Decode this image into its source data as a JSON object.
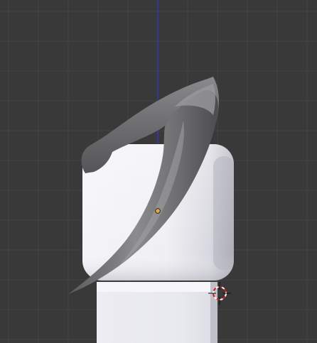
{
  "viewport": {
    "view": "3d-viewport",
    "background_color": "#393939",
    "grid_line_color": "#444444",
    "axis_color": "#3a3ad8",
    "grid_visible": true
  },
  "scene": {
    "objects": [
      {
        "name": "rounded-cube",
        "type": "mesh",
        "color": "#e8e8ee"
      },
      {
        "name": "pedestal-block",
        "type": "mesh",
        "color": "#dcdce4"
      },
      {
        "name": "curved-horn",
        "type": "mesh",
        "color": "#7c7c7c",
        "selected": true
      }
    ],
    "origin_point_color": "#e8a44a",
    "cursor_3d": {
      "icon": "3d-cursor-icon",
      "ring_colors": [
        "#cc2222",
        "#ffffff"
      ]
    }
  }
}
